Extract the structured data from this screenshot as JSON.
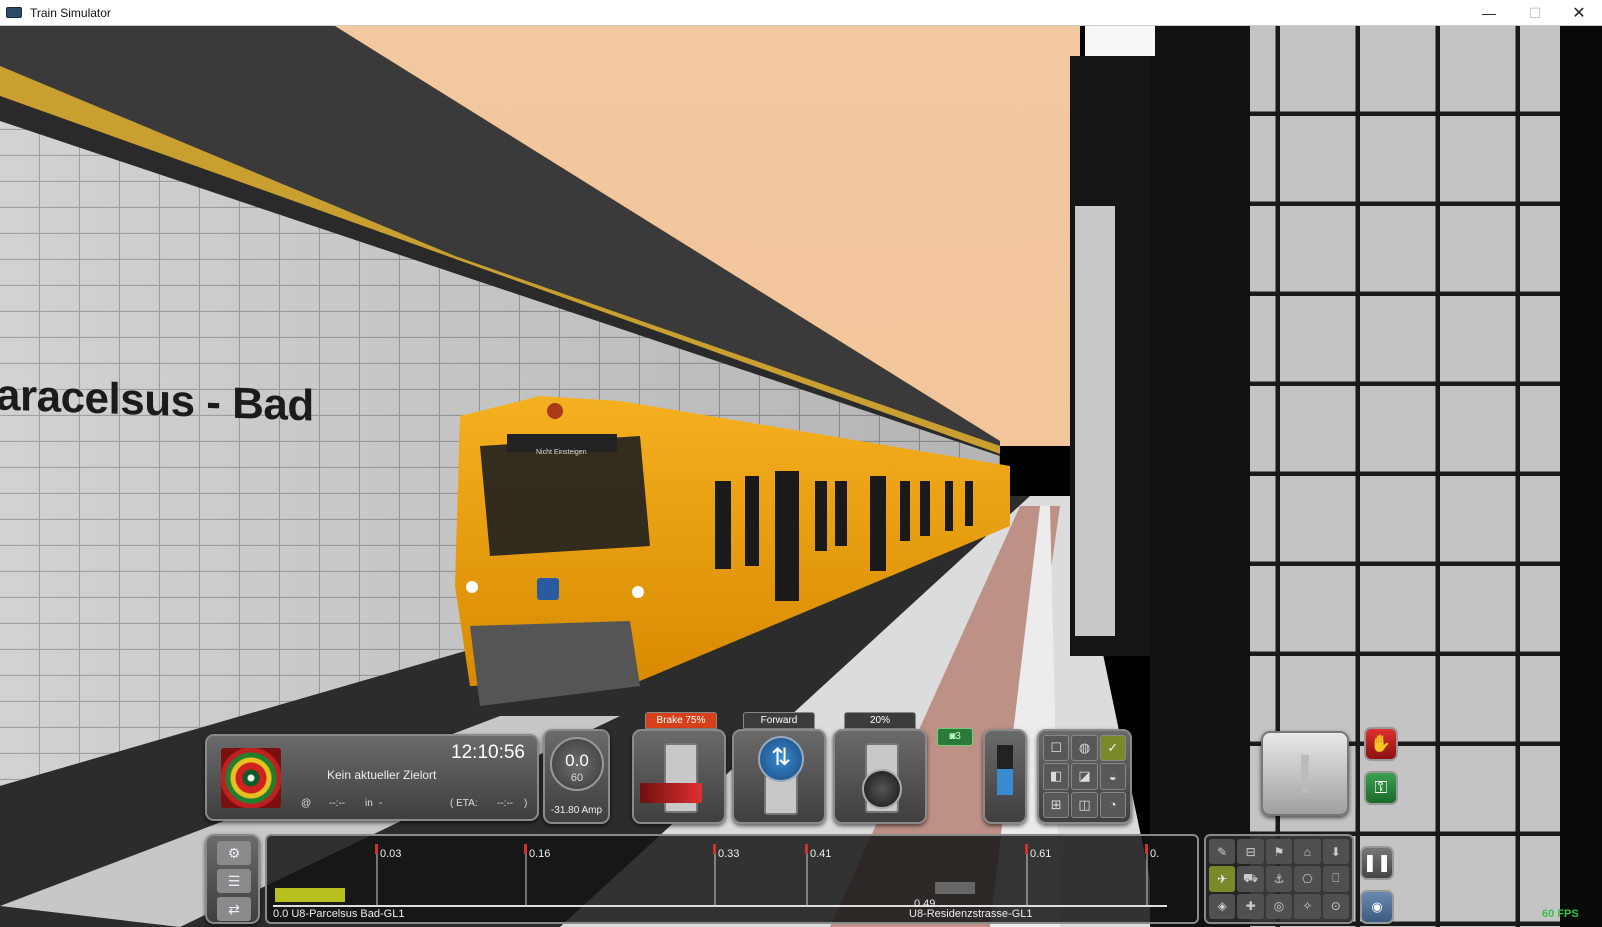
{
  "window": {
    "title": "Train Simulator",
    "minimize": "—",
    "maximize": "☐",
    "close": "✕"
  },
  "scene": {
    "station_sign": "aracelsus - Bad",
    "train_destination": "Nicht Einsteigen"
  },
  "hud": {
    "clock": "12:10:56",
    "destination": "Kein aktueller Zielort",
    "at_symbol": "@",
    "at_value": "--:--",
    "in_label": "in",
    "in_value": "-",
    "eta_label": "( ETA:",
    "eta_value": "--:--",
    "eta_close": ")",
    "speed": "0.0",
    "speed_limit": "60",
    "amps": "-31.80 Amp",
    "brake_label": "Brake 75%",
    "reverser_label": "Forward",
    "throttle_label": "20%",
    "reverser_arrows": "⇅",
    "camera_badge": "◙3",
    "alert_symbol": "!",
    "stop_symbol": "✋",
    "key_symbol": "⚿",
    "pause_symbol": "❚❚",
    "screenshot_symbol": "◉",
    "fps": "60 FPS"
  },
  "brake_level": 0.75,
  "throttle_level": 0.2,
  "track": {
    "distances": [
      "0.03",
      "0.16",
      "0.33",
      "0.41",
      "0.61",
      "0."
    ],
    "origin_station": "0.0 U8-Parcelsus Bad-GL1",
    "next_distance": "0.49",
    "next_station": "U8-Residenzstrasse-GL1"
  },
  "controls": {
    "grid_icons": [
      "☐",
      "◍",
      "✓",
      "◧",
      "◪",
      "◒",
      "⊞",
      "◫",
      "◔"
    ],
    "view_icons": [
      "✎",
      "⊟",
      "⚑",
      "⌂",
      "⬇",
      "✈",
      "⛟",
      "⚓",
      "⎔",
      "⎕",
      "◈",
      "✚",
      "◎",
      "✧",
      "⊙"
    ],
    "tool_icons": [
      "⚙",
      "☰",
      "⇄"
    ]
  }
}
